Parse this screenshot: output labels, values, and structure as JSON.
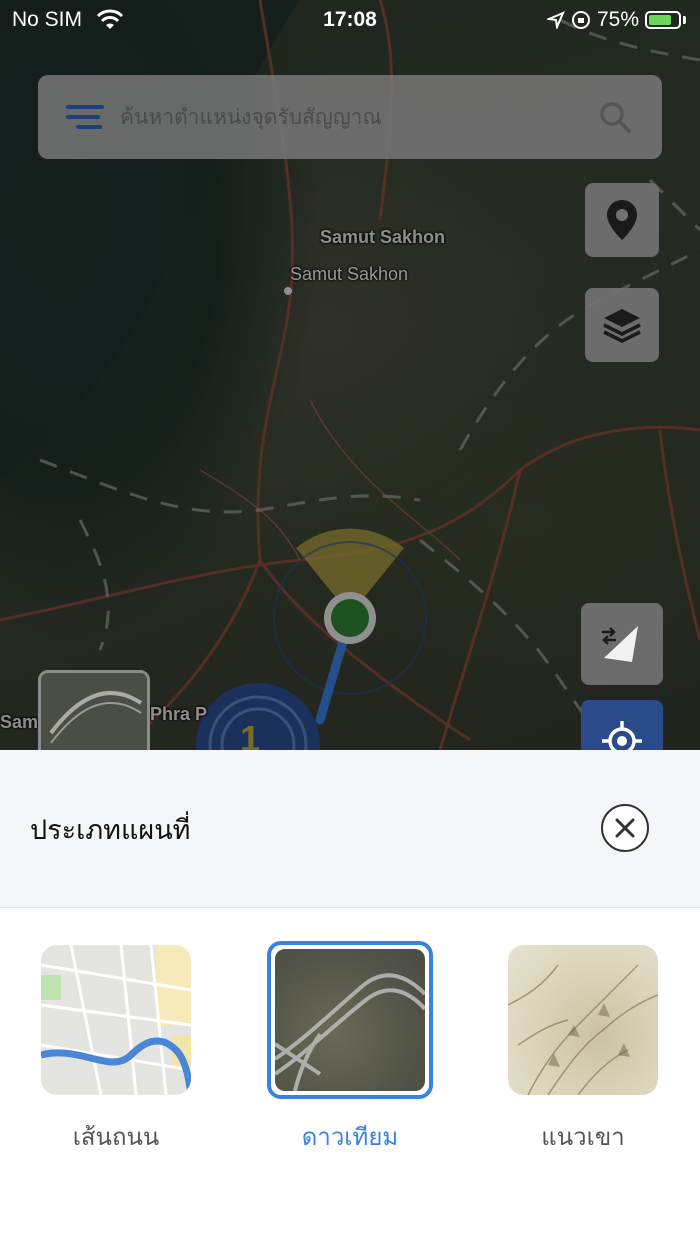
{
  "status_bar": {
    "carrier": "No SIM",
    "time": "17:08",
    "battery": "75%"
  },
  "search": {
    "placeholder": "ค้นหาตำแหน่งจุดรับสัญญาณ"
  },
  "map": {
    "labels": {
      "district": "Samut Sakhon",
      "city": "Samut Sakhon",
      "phra": "Phra P",
      "sam": "Sam"
    },
    "cluster_count": "1"
  },
  "sheet": {
    "title": "ประเภทแผนที่",
    "options": [
      {
        "label": "เส้นถนน",
        "selected": false
      },
      {
        "label": "ดาวเทียม",
        "selected": true
      },
      {
        "label": "แนวเขา",
        "selected": false
      }
    ]
  },
  "colors": {
    "accent": "#3a82e0",
    "locate_button": "#2a4a8a",
    "position_dot": "#2e7d32"
  }
}
